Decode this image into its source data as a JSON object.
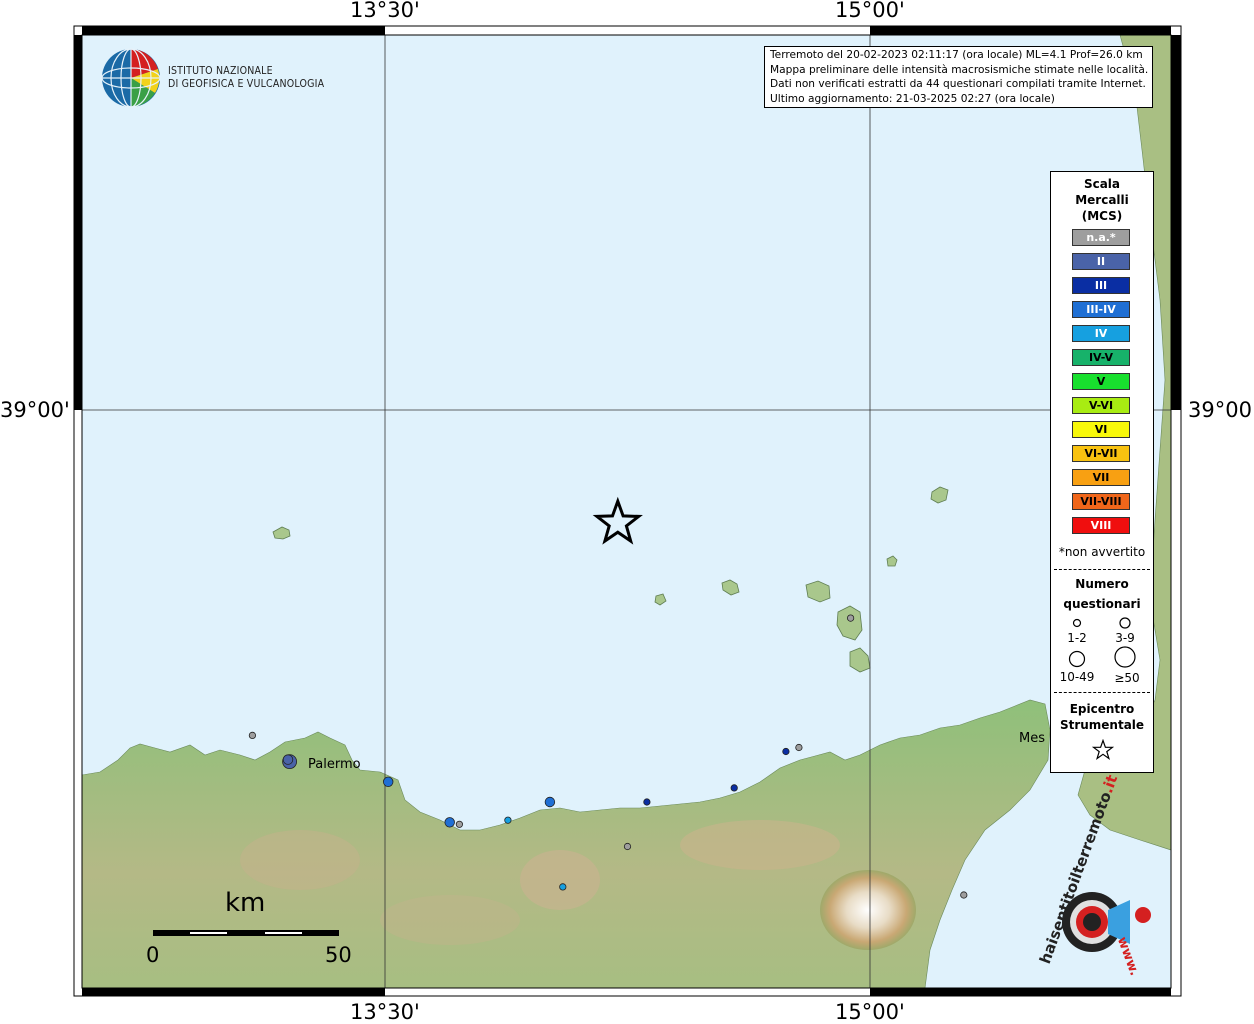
{
  "grid": {
    "lon_top": [
      "13°30'",
      "15°00'"
    ],
    "lon_bottom": [
      "13°30'",
      "15°00'"
    ],
    "lat_left": [
      "39°00'"
    ],
    "lat_right": [
      "39°00'"
    ]
  },
  "logo": {
    "line1": "ISTITUTO NAZIONALE",
    "line2": "DI GEOFISICA E VULCANOLOGIA"
  },
  "info": {
    "line1": "Terremoto del 20-02-2023 02:11:17 (ora locale) ML=4.1 Prof=26.0 km",
    "line2": "Mappa preliminare delle intensità macrosismiche stimate nelle località.",
    "line3": "Dati non verificati estratti da 44 questionari compilati tramite Internet.",
    "line4": "Ultimo aggiornamento: 21-03-2025 02:27 (ora locale)"
  },
  "legend": {
    "title1": "Scala",
    "title2": "Mercalli",
    "title3": "(MCS)",
    "classes": [
      {
        "label": "n.a.*",
        "color": "#9e9e9e",
        "text": "#ffffff"
      },
      {
        "label": "II",
        "color": "#4a63a8",
        "text": "#ffffff"
      },
      {
        "label": "III",
        "color": "#0a2ea3",
        "text": "#ffffff"
      },
      {
        "label": "III-IV",
        "color": "#1f6fd4",
        "text": "#ffffff"
      },
      {
        "label": "IV",
        "color": "#16a0e0",
        "text": "#ffffff"
      },
      {
        "label": "IV-V",
        "color": "#17b26a",
        "text": "#000000"
      },
      {
        "label": "V",
        "color": "#18e02e",
        "text": "#000000"
      },
      {
        "label": "V-VI",
        "color": "#a8ec12",
        "text": "#000000"
      },
      {
        "label": "VI",
        "color": "#f8f80a",
        "text": "#000000"
      },
      {
        "label": "VI-VII",
        "color": "#f8c210",
        "text": "#000000"
      },
      {
        "label": "VII",
        "color": "#f8a012",
        "text": "#000000"
      },
      {
        "label": "VII-VIII",
        "color": "#f0661a",
        "text": "#000000"
      },
      {
        "label": "VIII",
        "color": "#f00e0e",
        "text": "#ffffff"
      }
    ],
    "note": "*non avvertito",
    "count_title1": "Numero",
    "count_title2": "questionari",
    "count_classes": [
      "1-2",
      "3-9",
      "10-49",
      "≥50"
    ],
    "epi_title1": "Epicentro",
    "epi_title2": "Strumentale"
  },
  "places": {
    "palermo": "Palermo",
    "messina": "Mes"
  },
  "scalebar": {
    "unit": "km",
    "min": "0",
    "max": "50"
  },
  "hsn": {
    "text_a": "haisentito",
    "text_b": "ilterremoto",
    "text_c": ".it",
    "text_d": "www."
  },
  "observations": [
    {
      "lon": 13.205,
      "lat": 38.13,
      "class": "II",
      "count": "10-49"
    },
    {
      "lon": 13.2,
      "lat": 38.135,
      "class": "II",
      "count": "3-9"
    },
    {
      "lon": 13.09,
      "lat": 38.195,
      "class": "n.a.*",
      "count": "1-2"
    },
    {
      "lon": 13.51,
      "lat": 38.08,
      "class": "III-IV",
      "count": "3-9"
    },
    {
      "lon": 13.7,
      "lat": 37.98,
      "class": "III-IV",
      "count": "3-9"
    },
    {
      "lon": 13.73,
      "lat": 37.975,
      "class": "n.a.*",
      "count": "1-2"
    },
    {
      "lon": 13.88,
      "lat": 37.985,
      "class": "IV",
      "count": "1-2"
    },
    {
      "lon": 14.01,
      "lat": 38.03,
      "class": "III-IV",
      "count": "3-9"
    },
    {
      "lon": 14.31,
      "lat": 38.03,
      "class": "III",
      "count": "1-2"
    },
    {
      "lon": 14.58,
      "lat": 38.065,
      "class": "III",
      "count": "1-2"
    },
    {
      "lon": 14.74,
      "lat": 38.155,
      "class": "III",
      "count": "1-2"
    },
    {
      "lon": 14.78,
      "lat": 38.165,
      "class": "n.a.*",
      "count": "1-2"
    },
    {
      "lon": 14.25,
      "lat": 37.92,
      "class": "n.a.*",
      "count": "1-2"
    },
    {
      "lon": 14.05,
      "lat": 37.82,
      "class": "IV",
      "count": "1-2"
    },
    {
      "lon": 14.94,
      "lat": 38.485,
      "class": "n.a.*",
      "count": "1-2"
    },
    {
      "lon": 15.29,
      "lat": 37.8,
      "class": "n.a.*",
      "count": "1-2"
    }
  ],
  "epicenter": {
    "lon": 14.22,
    "lat": 38.72
  }
}
